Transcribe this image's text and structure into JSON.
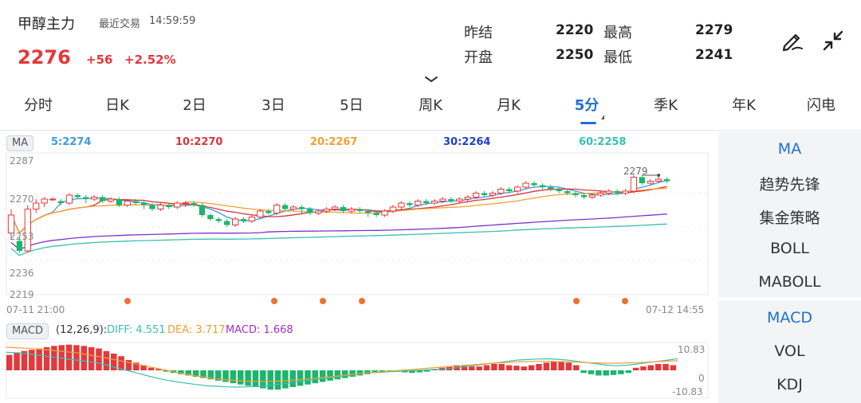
{
  "header": {
    "title": "甲醇主力",
    "trade_label": "最近交易",
    "trade_time": "14:59:59",
    "price": "2276",
    "change": "+56",
    "change_pct": "+2.52%"
  },
  "stats": {
    "prev_settle_label": "昨结",
    "prev_settle": "2220",
    "high_label": "最高",
    "high": "2279",
    "open_label": "开盘",
    "open": "2250",
    "low_label": "最低",
    "low": "2241"
  },
  "tabs": [
    {
      "label": "分时"
    },
    {
      "label": "日K"
    },
    {
      "label": "2日"
    },
    {
      "label": "3日"
    },
    {
      "label": "5日"
    },
    {
      "label": "周K"
    },
    {
      "label": "月K"
    },
    {
      "label": "5分"
    },
    {
      "label": "季K"
    },
    {
      "label": "年K"
    },
    {
      "label": "闪电"
    }
  ],
  "active_tab": "5分",
  "ma_legend": {
    "tag": "MA",
    "ma5": "5:2274",
    "ma10": "10:2270",
    "ma20": "20:2267",
    "ma30": "30:2264",
    "ma60": "60:2258"
  },
  "ma_colors": {
    "ma5": "#3c9be0",
    "ma10": "#d6363a",
    "ma20": "#f0a030",
    "ma30": "#7a35c8",
    "ma60": "#38c0b0"
  },
  "price_axis": [
    "2287",
    "2270",
    "2253",
    "2236",
    "2219"
  ],
  "high_marker": "2279",
  "time_axis": {
    "start": "07-11 21:00",
    "end": "07-12 14:55"
  },
  "macd_legend": {
    "tag": "MACD",
    "params": "(12,26,9):",
    "diff": "DIFF: 4.551",
    "dea": "DEA: 3.717",
    "macd": "MACD: 1.668"
  },
  "macd_axis": [
    "10.83",
    "0",
    "-10.83"
  ],
  "side_panel": {
    "main_indicators": [
      "MA",
      "趋势先锋",
      "集金策略",
      "BOLL",
      "MABOLL"
    ],
    "sub_indicators": [
      "MACD",
      "VOL",
      "KDJ"
    ]
  },
  "colors": {
    "up": "#e3383c",
    "down": "#1bb56b",
    "accent": "#1f6fd1"
  },
  "chart_data": {
    "type": "candlestick",
    "interval": "5分",
    "candles": [
      [
        2250,
        2259,
        2247,
        2262
      ],
      [
        2246,
        2241,
        2240,
        2248
      ],
      [
        2241,
        2262,
        2240,
        2264
      ],
      [
        2262,
        2265,
        2260,
        2267
      ],
      [
        2265,
        2267,
        2263,
        2268
      ],
      [
        2267,
        2267,
        2266,
        2268
      ],
      [
        2266,
        2265,
        2264,
        2267
      ],
      [
        2265,
        2269,
        2264,
        2270
      ],
      [
        2269,
        2268,
        2267,
        2270
      ],
      [
        2268,
        2267,
        2265,
        2269
      ],
      [
        2267,
        2268,
        2266,
        2269
      ],
      [
        2268,
        2266,
        2265,
        2269
      ],
      [
        2266,
        2267,
        2265,
        2268
      ],
      [
        2267,
        2264,
        2263,
        2268
      ],
      [
        2264,
        2266,
        2263,
        2267
      ],
      [
        2266,
        2265,
        2264,
        2267
      ],
      [
        2265,
        2264,
        2262,
        2266
      ],
      [
        2264,
        2262,
        2261,
        2265
      ],
      [
        2262,
        2264,
        2261,
        2265
      ],
      [
        2264,
        2263,
        2262,
        2265
      ],
      [
        2263,
        2265,
        2262,
        2266
      ],
      [
        2265,
        2265,
        2263,
        2266
      ],
      [
        2265,
        2264,
        2263,
        2266
      ],
      [
        2264,
        2259,
        2258,
        2265
      ],
      [
        2259,
        2257,
        2256,
        2260
      ],
      [
        2257,
        2256,
        2255,
        2258
      ],
      [
        2256,
        2254,
        2253,
        2257
      ],
      [
        2254,
        2257,
        2253,
        2258
      ],
      [
        2257,
        2256,
        2255,
        2258
      ],
      [
        2256,
        2258,
        2255,
        2259
      ],
      [
        2258,
        2261,
        2257,
        2262
      ],
      [
        2261,
        2260,
        2259,
        2262
      ],
      [
        2260,
        2264,
        2259,
        2265
      ],
      [
        2264,
        2262,
        2261,
        2265
      ],
      [
        2262,
        2263,
        2261,
        2264
      ],
      [
        2263,
        2262,
        2260,
        2264
      ],
      [
        2262,
        2260,
        2259,
        2263
      ],
      [
        2260,
        2261,
        2259,
        2262
      ],
      [
        2261,
        2262,
        2260,
        2263
      ],
      [
        2262,
        2263,
        2261,
        2264
      ],
      [
        2263,
        2261,
        2260,
        2264
      ],
      [
        2261,
        2262,
        2260,
        2263
      ],
      [
        2262,
        2261,
        2260,
        2263
      ],
      [
        2261,
        2260,
        2258,
        2262
      ],
      [
        2260,
        2259,
        2258,
        2261
      ],
      [
        2259,
        2261,
        2258,
        2262
      ],
      [
        2261,
        2263,
        2260,
        2264
      ],
      [
        2263,
        2265,
        2262,
        2266
      ],
      [
        2265,
        2264,
        2263,
        2266
      ],
      [
        2264,
        2266,
        2263,
        2267
      ],
      [
        2266,
        2265,
        2264,
        2267
      ],
      [
        2265,
        2266,
        2264,
        2267
      ],
      [
        2266,
        2267,
        2265,
        2268
      ],
      [
        2267,
        2266,
        2265,
        2268
      ],
      [
        2266,
        2267,
        2265,
        2268
      ],
      [
        2267,
        2268,
        2266,
        2269
      ],
      [
        2268,
        2270,
        2267,
        2271
      ],
      [
        2270,
        2269,
        2268,
        2271
      ],
      [
        2269,
        2270,
        2268,
        2271
      ],
      [
        2270,
        2272,
        2269,
        2273
      ],
      [
        2272,
        2271,
        2270,
        2273
      ],
      [
        2271,
        2273,
        2270,
        2274
      ],
      [
        2273,
        2275,
        2272,
        2276
      ],
      [
        2275,
        2274,
        2273,
        2276
      ],
      [
        2274,
        2273,
        2272,
        2275
      ],
      [
        2273,
        2272,
        2271,
        2274
      ],
      [
        2272,
        2271,
        2270,
        2273
      ],
      [
        2271,
        2270,
        2269,
        2272
      ],
      [
        2270,
        2269,
        2268,
        2271
      ],
      [
        2269,
        2268,
        2267,
        2270
      ],
      [
        2268,
        2269,
        2267,
        2270
      ],
      [
        2269,
        2270,
        2268,
        2271
      ],
      [
        2270,
        2271,
        2269,
        2272
      ],
      [
        2271,
        2270,
        2269,
        2272
      ],
      [
        2270,
        2271,
        2269,
        2272
      ],
      [
        2271,
        2278,
        2270,
        2279
      ],
      [
        2278,
        2275,
        2274,
        2279
      ],
      [
        2275,
        2276,
        2274,
        2277
      ],
      [
        2276,
        2277,
        2275,
        2279
      ],
      [
        2277,
        2276,
        2275,
        2278
      ]
    ],
    "candle_fields": [
      "open",
      "close",
      "low",
      "high"
    ],
    "ylim": [
      2219,
      2287
    ],
    "signal_markers": [
      17,
      38,
      47,
      55,
      117,
      131
    ],
    "macd_hist": [
      6,
      7,
      7.5,
      8,
      8.5,
      9,
      9.5,
      9.8,
      10,
      9.8,
      9.5,
      9,
      8.5,
      7.5,
      6.5,
      5.5,
      4,
      3,
      2,
      1,
      0.5,
      -0.5,
      -1,
      -1.5,
      -2,
      -2.5,
      -3,
      -3.5,
      -4,
      -4.5,
      -5,
      -5.5,
      -6,
      -6.5,
      -7,
      -7.5,
      -7.5,
      -7,
      -6.5,
      -6,
      -5.5,
      -5,
      -4.5,
      -4,
      -3.5,
      -3,
      -2.5,
      -2,
      -1.5,
      -1,
      -0.8,
      -0.6,
      -0.5,
      -0.8,
      -1,
      -0.8,
      -0.5,
      0.5,
      1,
      1.5,
      2,
      1.8,
      1.5,
      1.5,
      2,
      2.5,
      2.5,
      2,
      1.8,
      1.5,
      2,
      2.5,
      3,
      3.5,
      3.5,
      3,
      2,
      -1,
      -1.5,
      -2,
      -2,
      -1.8,
      -1.5,
      -1,
      1,
      1.5,
      2,
      2.5,
      2.5,
      2
    ],
    "diff": [
      7,
      6.8,
      6.5,
      6,
      5.5,
      5,
      4.5,
      4,
      3.5,
      3,
      2,
      1,
      0,
      -1,
      -2,
      -3,
      -3.8,
      -4.5,
      -5,
      -5.5,
      -6,
      -6.2,
      -6.4,
      -6.5,
      -6.4,
      -6.2,
      -6,
      -5.5,
      -5,
      -4.5,
      -4,
      -3.5,
      -3,
      -2.5,
      -2,
      -1.5,
      -1,
      -0.8,
      -0.6,
      -0.4,
      -0.2,
      0,
      0.2,
      0.4,
      0.6,
      1,
      1.5,
      2,
      2.5,
      3,
      3.5,
      4,
      4.2,
      4.4,
      4.5,
      4.3,
      4,
      3.5,
      3,
      2.5,
      2,
      1.8,
      2,
      2.5,
      3,
      3.5,
      4,
      4.551
    ],
    "dea": [
      9,
      8.8,
      8.6,
      8.3,
      8,
      7.6,
      7.2,
      6.8,
      6.2,
      5.5,
      4.8,
      4,
      3.2,
      2.4,
      1.6,
      0.8,
      0,
      -0.8,
      -1.5,
      -2.2,
      -2.8,
      -3.3,
      -3.7,
      -4,
      -4.2,
      -4.3,
      -4.3,
      -4.2,
      -4,
      -3.7,
      -3.4,
      -3,
      -2.6,
      -2.2,
      -1.8,
      -1.4,
      -1,
      -0.7,
      -0.4,
      -0.1,
      0.2,
      0.5,
      0.8,
      1.1,
      1.4,
      1.7,
      2,
      2.3,
      2.6,
      2.9,
      3.1,
      3.3,
      3.4,
      3.5,
      3.5,
      3.4,
      3.3,
      3.2,
      3,
      2.9,
      2.8,
      2.8,
      2.9,
      3,
      3.2,
      3.4,
      3.6,
      3.717
    ],
    "macd_ylim": [
      -10.83,
      10.83
    ]
  }
}
